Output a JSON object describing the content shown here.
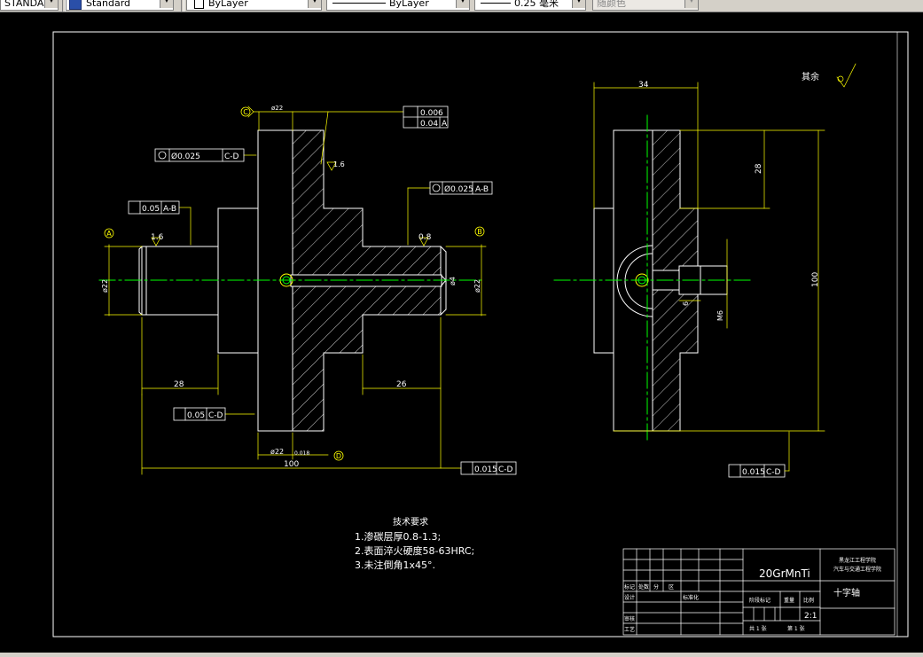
{
  "toolbar": {
    "text_style": "STANDARD",
    "dim_style": "Standard",
    "layer": "ByLayer",
    "linetype": "ByLayer",
    "lineweight": "0.25 毫米",
    "plot_style": "随颜色"
  },
  "drawing": {
    "roughness_other": "其余",
    "datum_A": "A",
    "datum_B": "B",
    "datum_C": "C",
    "datum_D": "D",
    "fcf_top_1": "0.006",
    "fcf_top_2": "0.04",
    "fcf_top_2_ref": "A",
    "fcf_left_1_val": "Ø0.025",
    "fcf_left_1_ref": "C-D",
    "fcf_mid_val": "Ø0.025",
    "fcf_mid_ref": "A-B",
    "fcf_runout_top_val": "0.05",
    "fcf_runout_top_ref": "A-B",
    "fcf_runout_bot_val": "0.05",
    "fcf_runout_bot_ref": "C-D",
    "fcf_sym_left_val": "0.015",
    "fcf_sym_left_ref": "C-D",
    "fcf_sym_right_val": "0.015",
    "fcf_sym_right_ref": "C-D",
    "dim_phi22_top": "ø22",
    "dim_phi22_bot": "ø22",
    "dim_phi22_bot_tol": "0.018",
    "dim_phi22_left": "ø22",
    "dim_phi22_right": "ø22",
    "rough_1_6": "1.6",
    "rough_0_8": "0.8",
    "rough_1_6_b": "1.6",
    "dim_28_left": "28",
    "dim_26": "26",
    "dim_100_bottom": "100",
    "dim_phi4": "ø4",
    "dim_34": "34",
    "dim_28_right": "28",
    "dim_100_right": "100",
    "dim_6": "6",
    "dim_M6": "M6",
    "tech_title": "技术要求",
    "tech_1": "1.渗碳层厚0.8-1.3;",
    "tech_2": "2.表面淬火硬度58-63HRC;",
    "tech_3": "3.未注倒角1x45°."
  },
  "title_block": {
    "material": "20GrMnTi",
    "school_1": "黑龙江工程学院",
    "school_2": "汽车与交通工程学院",
    "part_name": "十字轴",
    "scale": "2:1",
    "row_label_1": "标记",
    "row_label_2": "处数",
    "row_label_3": "分",
    "row_label_4": "区",
    "design": "设计",
    "review": "审核",
    "process": "工艺",
    "stage": "阶段标记",
    "weight": "重量",
    "ratio": "比例",
    "sheets_1": "共 1 张",
    "sheets_2": "第 1 张",
    "std": "标准化"
  },
  "colors": {
    "white": "#ffffff",
    "yellow": "#ffff00",
    "green": "#00ff00",
    "bg": "#000000"
  }
}
